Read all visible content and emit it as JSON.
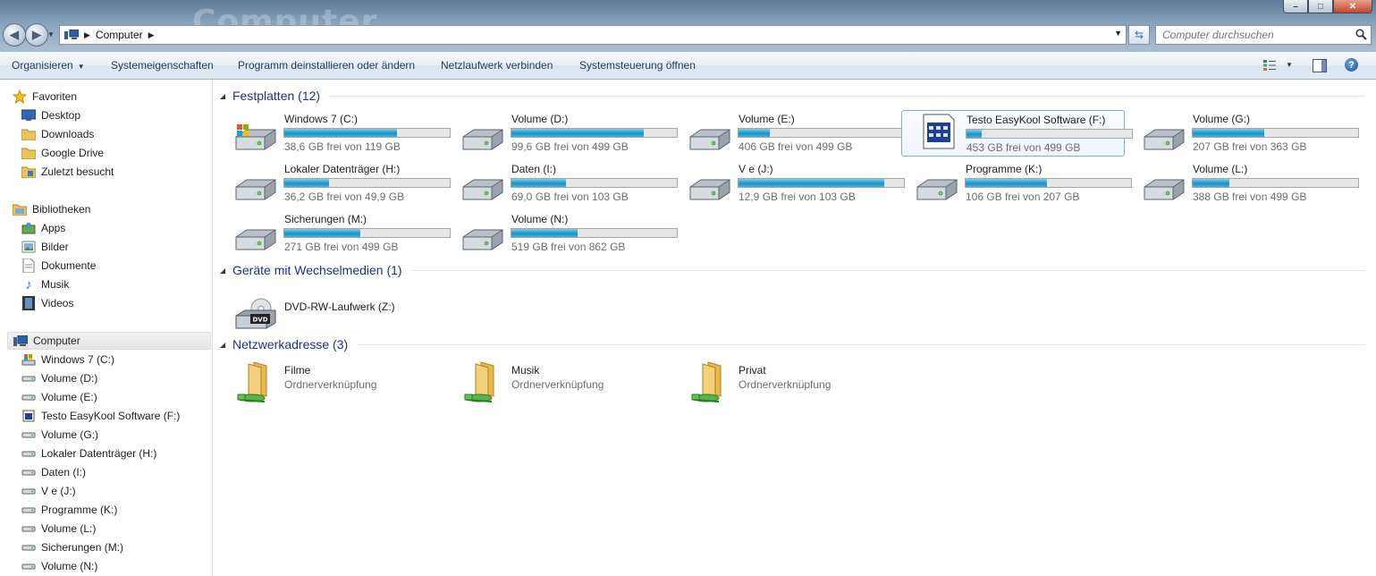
{
  "window": {
    "title_watermark": "Computer",
    "controls": [
      "minimize",
      "maximize",
      "close"
    ]
  },
  "address": {
    "breadcrumb": "Computer",
    "search_placeholder": "Computer durchsuchen"
  },
  "toolbar": {
    "organize": "Organisieren",
    "system_properties": "Systemeigenschaften",
    "uninstall": "Programm deinstallieren oder ändern",
    "map_drive": "Netzlaufwerk verbinden",
    "control_panel": "Systemsteuerung öffnen"
  },
  "sidebar": {
    "favorites": {
      "label": "Favoriten",
      "items": [
        {
          "label": "Desktop",
          "icon": "desktop-icon"
        },
        {
          "label": "Downloads",
          "icon": "folder-icon"
        },
        {
          "label": "Google Drive",
          "icon": "folder-icon"
        },
        {
          "label": "Zuletzt besucht",
          "icon": "recent-places-icon"
        }
      ]
    },
    "libraries": {
      "label": "Bibliotheken",
      "items": [
        {
          "label": "Apps",
          "icon": "apps-icon"
        },
        {
          "label": "Bilder",
          "icon": "pictures-icon"
        },
        {
          "label": "Dokumente",
          "icon": "documents-icon"
        },
        {
          "label": "Musik",
          "icon": "music-icon"
        },
        {
          "label": "Videos",
          "icon": "videos-icon"
        }
      ]
    },
    "computer": {
      "label": "Computer",
      "items": [
        {
          "label": "Windows 7 (C:)",
          "icon": "system-drive-icon"
        },
        {
          "label": "Volume (D:)",
          "icon": "drive-icon"
        },
        {
          "label": "Volume (E:)",
          "icon": "drive-icon"
        },
        {
          "label": "Testo EasyKool Software (F:)",
          "icon": "app-drive-icon"
        },
        {
          "label": "Volume (G:)",
          "icon": "drive-icon"
        },
        {
          "label": "Lokaler Datenträger (H:)",
          "icon": "drive-icon"
        },
        {
          "label": "Daten (I:)",
          "icon": "drive-icon"
        },
        {
          "label": "V e (J:)",
          "icon": "drive-icon"
        },
        {
          "label": "Programme (K:)",
          "icon": "drive-icon"
        },
        {
          "label": "Volume (L:)",
          "icon": "drive-icon"
        },
        {
          "label": "Sicherungen (M:)",
          "icon": "drive-icon"
        },
        {
          "label": "Volume (N:)",
          "icon": "drive-icon"
        }
      ]
    }
  },
  "groups": {
    "hard_disks": {
      "title": "Festplatten (12)",
      "drives": [
        {
          "name": "Windows 7 (C:)",
          "free": "38,6 GB frei von 119 GB",
          "used_fraction": 0.68,
          "icon": "system-drive-icon"
        },
        {
          "name": "Volume (D:)",
          "free": "99,6 GB frei von 499 GB",
          "used_fraction": 0.8,
          "icon": "drive-icon"
        },
        {
          "name": "Volume (E:)",
          "free": "406 GB frei von 499 GB",
          "used_fraction": 0.19,
          "icon": "drive-icon"
        },
        {
          "name": "Testo EasyKool Software (F:)",
          "free": "453 GB frei von 499 GB",
          "used_fraction": 0.09,
          "icon": "app-drive-icon",
          "selected": true
        },
        {
          "name": "Volume (G:)",
          "free": "207 GB frei von 363 GB",
          "used_fraction": 0.43,
          "icon": "drive-icon"
        },
        {
          "name": "Lokaler Datenträger (H:)",
          "free": "36,2 GB frei von 49,9 GB",
          "used_fraction": 0.27,
          "icon": "drive-icon"
        },
        {
          "name": "Daten (I:)",
          "free": "69,0 GB frei von 103 GB",
          "used_fraction": 0.33,
          "icon": "drive-icon"
        },
        {
          "name": "V e (J:)",
          "free": "12,9 GB frei von 103 GB",
          "used_fraction": 0.88,
          "icon": "drive-icon"
        },
        {
          "name": "Programme (K:)",
          "free": "106 GB frei von 207 GB",
          "used_fraction": 0.49,
          "icon": "drive-icon"
        },
        {
          "name": "Volume (L:)",
          "free": "388 GB frei von 499 GB",
          "used_fraction": 0.22,
          "icon": "drive-icon"
        },
        {
          "name": "Sicherungen (M:)",
          "free": "271 GB frei von 499 GB",
          "used_fraction": 0.46,
          "icon": "drive-icon"
        },
        {
          "name": "Volume (N:)",
          "free": "519 GB frei von 862 GB",
          "used_fraction": 0.4,
          "icon": "drive-icon"
        }
      ]
    },
    "removable": {
      "title": "Geräte mit Wechselmedien (1)",
      "items": [
        {
          "name": "DVD-RW-Laufwerk (Z:)",
          "icon": "dvd-drive-icon",
          "badge": "DVD"
        }
      ]
    },
    "network": {
      "title": "Netzwerkadresse (3)",
      "items": [
        {
          "name": "Filme",
          "type": "Ordnerverknüpfung",
          "icon": "network-folder-icon"
        },
        {
          "name": "Musik",
          "type": "Ordnerverknüpfung",
          "icon": "network-folder-icon"
        },
        {
          "name": "Privat",
          "type": "Ordnerverknüpfung",
          "icon": "network-folder-icon"
        }
      ]
    }
  },
  "colors": {
    "accent": "#1e3287",
    "bar_fill": "#26a0da",
    "selection_border": "#84acdd"
  }
}
